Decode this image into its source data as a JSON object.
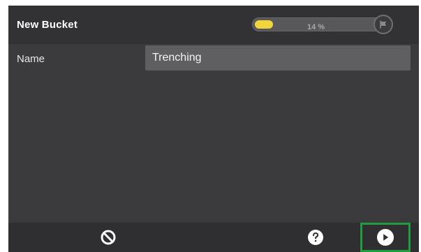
{
  "header": {
    "title": "New Bucket",
    "progress_label": "14 %",
    "progress_value": 0.14,
    "progress_color": "#f2d53c",
    "flag_icon": "flag-icon"
  },
  "form": {
    "name_label": "Name",
    "name_value": "Trenching"
  },
  "footer": {
    "cancel_icon": "cancel-icon",
    "help_icon": "help-icon",
    "next_icon": "next-icon",
    "highlight_color": "#1f9d3f"
  }
}
